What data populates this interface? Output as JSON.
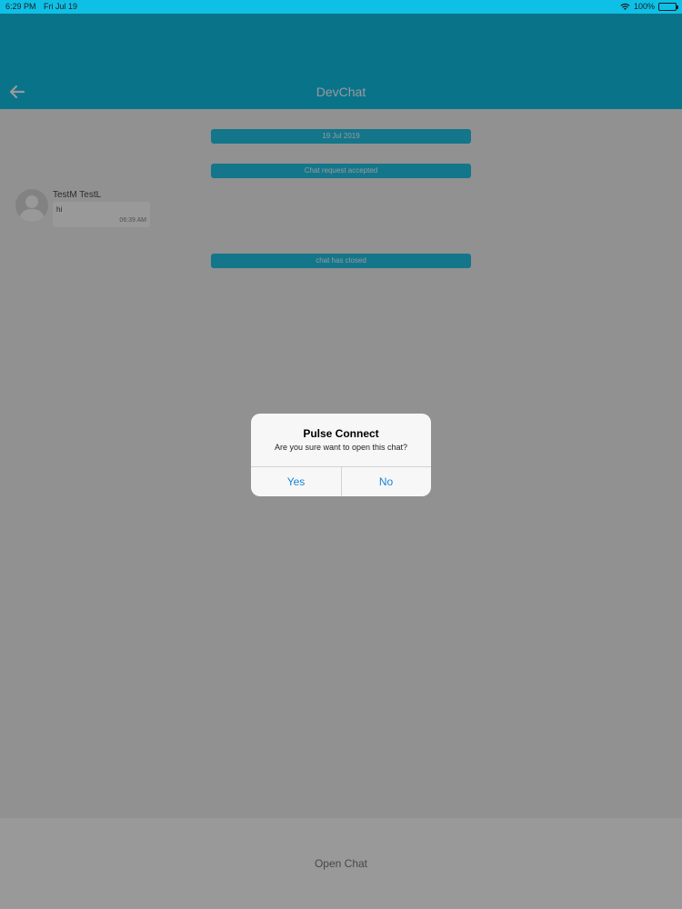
{
  "status_bar": {
    "time": "6:29 PM",
    "date": "Fri Jul 19",
    "battery": "100%"
  },
  "nav": {
    "title": "DevChat",
    "back_icon": "arrow-left-icon"
  },
  "chat": {
    "date_divider": "19 Jul 2019",
    "accepted_notice": "Chat request accepted",
    "closed_notice": "chat has closed",
    "message": {
      "sender": "TestM TestL",
      "text": "hi",
      "time": "06:39 AM"
    }
  },
  "bottom_bar": {
    "open_chat_label": "Open Chat"
  },
  "alert": {
    "title": "Pulse Connect",
    "message": "Are you sure want to open this chat?",
    "yes_label": "Yes",
    "no_label": "No"
  },
  "colors": {
    "accent": "#0fc0e6",
    "link": "#1a84d6"
  }
}
